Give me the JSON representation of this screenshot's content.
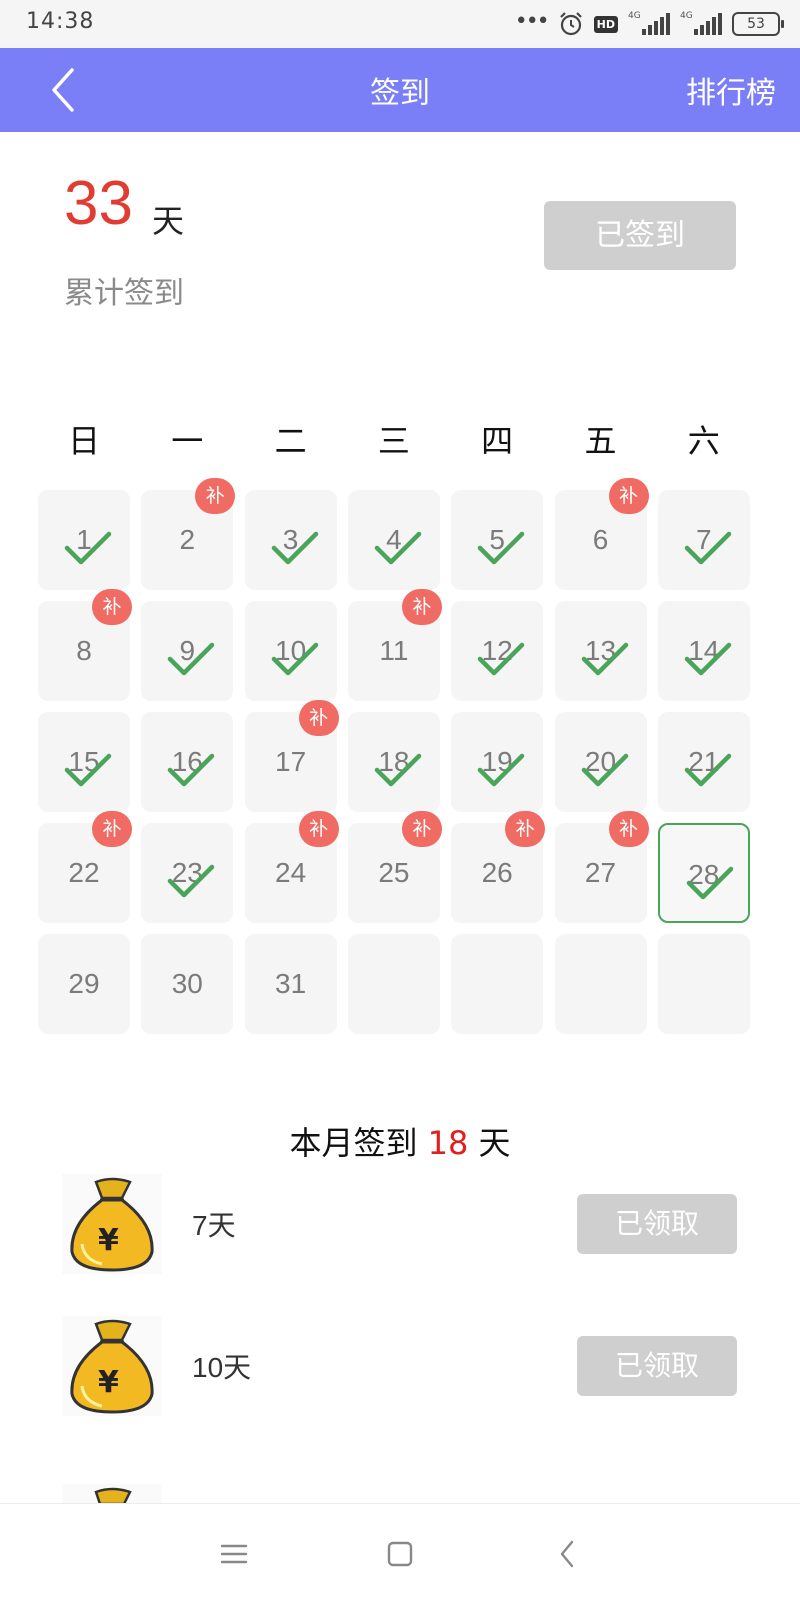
{
  "status_bar": {
    "time": "14:38",
    "dots": "•••",
    "hd": "HD",
    "net1": "4G",
    "net2": "4G",
    "battery": "53",
    "icons": [
      "more-icon",
      "alarm-icon",
      "hd-icon",
      "signal-icon",
      "signal-icon",
      "battery-icon"
    ]
  },
  "nav": {
    "title": "签到",
    "right_label": "排行榜",
    "back_icon": "chevron-left-icon",
    "color": "#7a7ff8"
  },
  "summary": {
    "total_days": "33",
    "unit": "天",
    "label": "累计签到",
    "button_label": "已签到"
  },
  "weekdays": [
    "日",
    "一",
    "二",
    "三",
    "四",
    "五",
    "六"
  ],
  "calendar": {
    "days": [
      {
        "day": "1",
        "checked": true,
        "makeup": false
      },
      {
        "day": "2",
        "checked": false,
        "makeup": true
      },
      {
        "day": "3",
        "checked": true,
        "makeup": false
      },
      {
        "day": "4",
        "checked": true,
        "makeup": false
      },
      {
        "day": "5",
        "checked": true,
        "makeup": false
      },
      {
        "day": "6",
        "checked": false,
        "makeup": true
      },
      {
        "day": "7",
        "checked": true,
        "makeup": false
      },
      {
        "day": "8",
        "checked": false,
        "makeup": true
      },
      {
        "day": "9",
        "checked": true,
        "makeup": false
      },
      {
        "day": "10",
        "checked": true,
        "makeup": false
      },
      {
        "day": "11",
        "checked": false,
        "makeup": true
      },
      {
        "day": "12",
        "checked": true,
        "makeup": false
      },
      {
        "day": "13",
        "checked": true,
        "makeup": false
      },
      {
        "day": "14",
        "checked": true,
        "makeup": false
      },
      {
        "day": "15",
        "checked": true,
        "makeup": false
      },
      {
        "day": "16",
        "checked": true,
        "makeup": false
      },
      {
        "day": "17",
        "checked": false,
        "makeup": true
      },
      {
        "day": "18",
        "checked": true,
        "makeup": false
      },
      {
        "day": "19",
        "checked": true,
        "makeup": false
      },
      {
        "day": "20",
        "checked": true,
        "makeup": false
      },
      {
        "day": "21",
        "checked": true,
        "makeup": false
      },
      {
        "day": "22",
        "checked": false,
        "makeup": true
      },
      {
        "day": "23",
        "checked": true,
        "makeup": false
      },
      {
        "day": "24",
        "checked": false,
        "makeup": true
      },
      {
        "day": "25",
        "checked": false,
        "makeup": true
      },
      {
        "day": "26",
        "checked": false,
        "makeup": true
      },
      {
        "day": "27",
        "checked": false,
        "makeup": true
      },
      {
        "day": "28",
        "checked": true,
        "makeup": false,
        "today": true
      },
      {
        "day": "29",
        "checked": false,
        "makeup": false
      },
      {
        "day": "30",
        "checked": false,
        "makeup": false
      },
      {
        "day": "31",
        "checked": false,
        "makeup": false
      },
      {
        "day": "",
        "checked": false,
        "makeup": false
      },
      {
        "day": "",
        "checked": false,
        "makeup": false
      },
      {
        "day": "",
        "checked": false,
        "makeup": false
      },
      {
        "day": "",
        "checked": false,
        "makeup": false
      }
    ],
    "makeup_label": "补",
    "check_color": "#4aa55a",
    "makeup_color": "#ef6b63"
  },
  "month": {
    "prefix": "本月签到",
    "count": "18",
    "suffix": "天"
  },
  "rewards": [
    {
      "days_label": "7天",
      "button_label": "已领取",
      "icon": "money-bag-icon"
    },
    {
      "days_label": "10天",
      "button_label": "已领取",
      "icon": "money-bag-icon"
    }
  ],
  "system_nav": [
    "menu-icon",
    "home-icon",
    "back-icon"
  ]
}
